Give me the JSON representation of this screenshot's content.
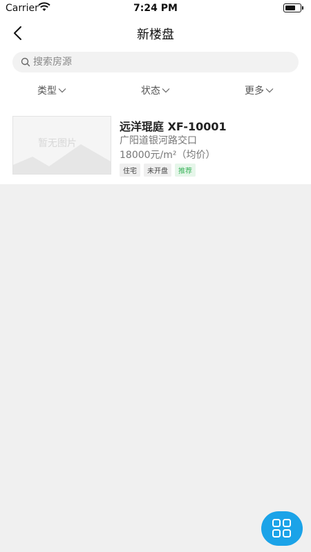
{
  "status_bar": {
    "carrier": "Carrier",
    "time": "7:24 PM",
    "icons": [
      "wifi-icon",
      "battery-icon"
    ]
  },
  "nav": {
    "title": "新楼盘",
    "back_icon": "back-arrow-icon"
  },
  "search": {
    "placeholder": "搜索房源",
    "value": "",
    "icon": "search-icon"
  },
  "filters": [
    {
      "label": "类型",
      "icon": "chevron-down-icon"
    },
    {
      "label": "状态",
      "icon": "chevron-down-icon"
    },
    {
      "label": "更多",
      "icon": "chevron-down-icon"
    }
  ],
  "listings": [
    {
      "image_placeholder_text": "暂无图片",
      "title": "远洋琨庭 XF-10001",
      "address": "广阳道银河路交口",
      "price": "18000元/m²（均价）",
      "tags": [
        {
          "label": "住宅",
          "style": "normal"
        },
        {
          "label": "未开盘",
          "style": "normal"
        },
        {
          "label": "推荐",
          "style": "highlight"
        }
      ]
    }
  ],
  "fab": {
    "icon": "grid-menu-icon",
    "color": "#1ba3e8"
  },
  "colors": {
    "accent": "#1ba3e8",
    "tag_highlight_text": "#3cb45c",
    "tag_highlight_bg": "#e6f6ea"
  }
}
